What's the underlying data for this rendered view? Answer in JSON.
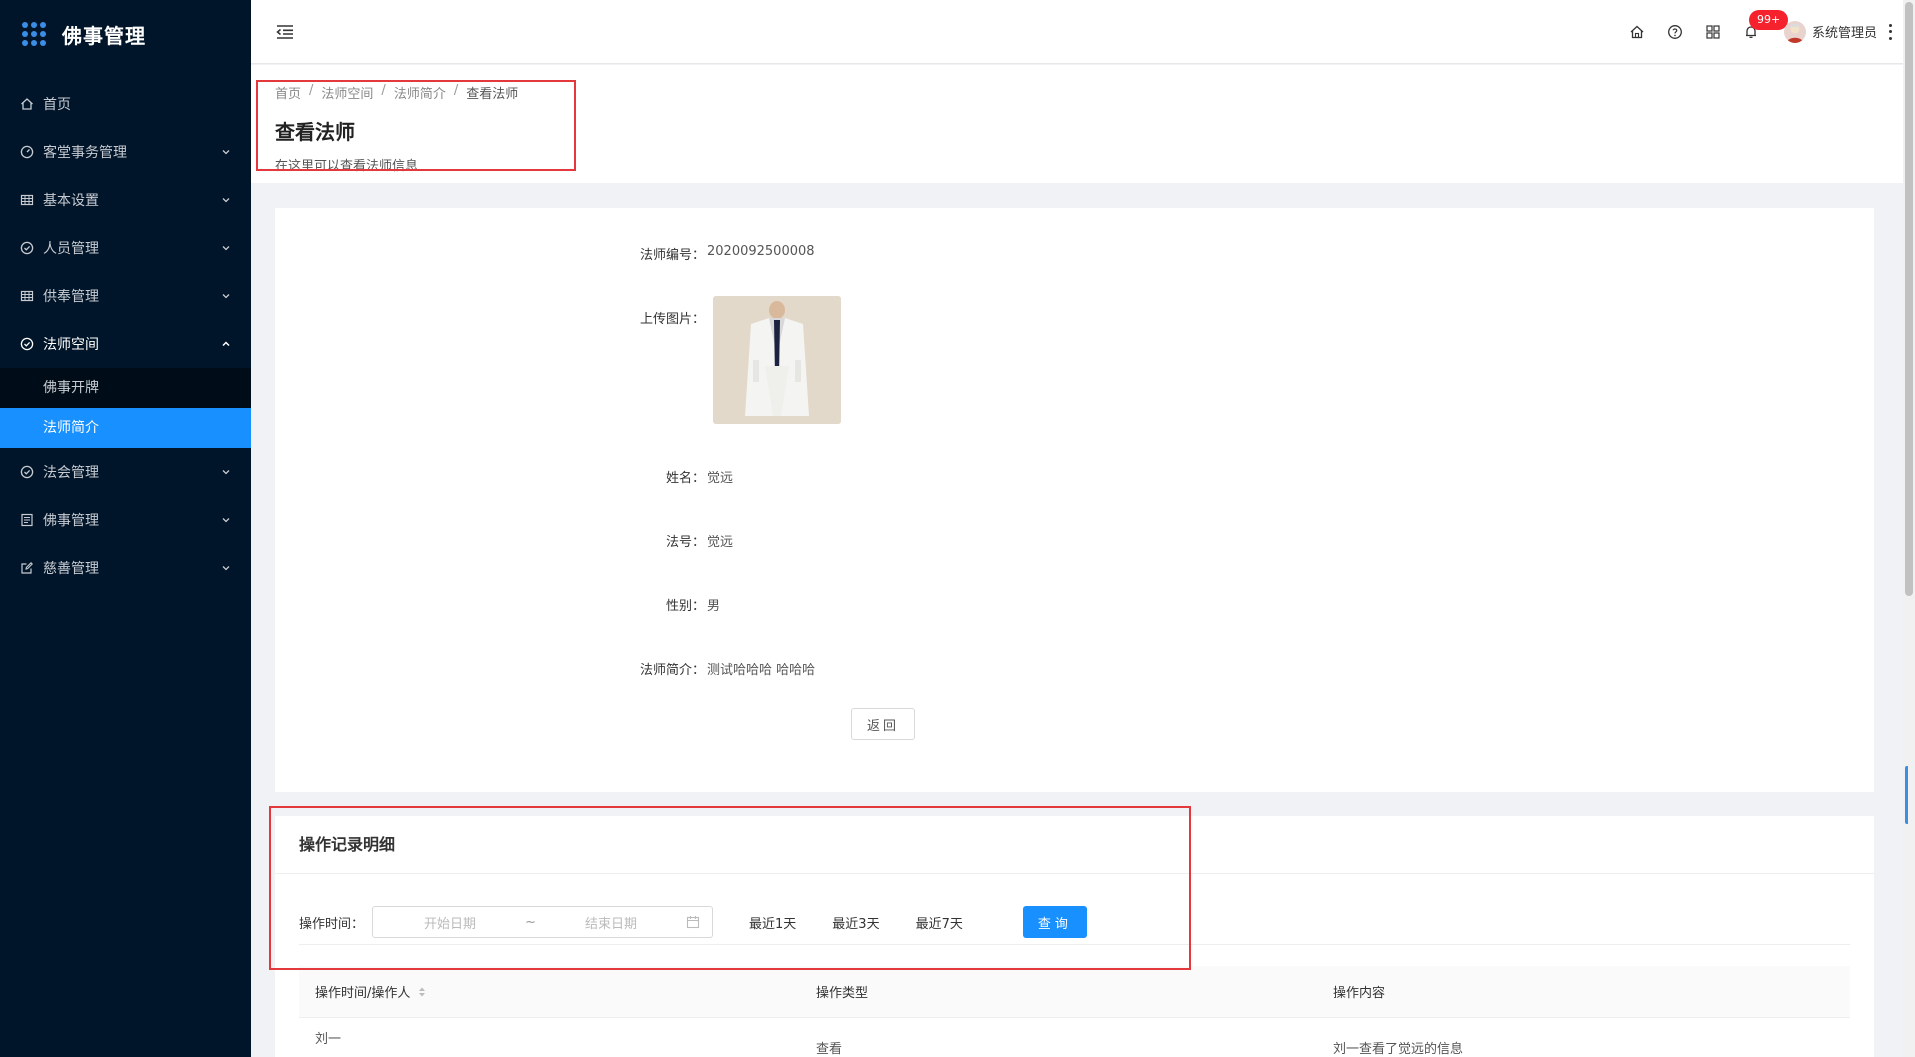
{
  "app": {
    "title": "佛事管理"
  },
  "sidebar": {
    "items": [
      {
        "label": "首页",
        "icon": "home-icon",
        "expandable": false
      },
      {
        "label": "客堂事务管理",
        "icon": "dashboard-icon",
        "expandable": true
      },
      {
        "label": "基本设置",
        "icon": "table-icon",
        "expandable": true
      },
      {
        "label": "人员管理",
        "icon": "check-circle-icon",
        "expandable": true
      },
      {
        "label": "供奉管理",
        "icon": "table-icon",
        "expandable": true
      },
      {
        "label": "法师空间",
        "icon": "check-circle-icon",
        "expandable": true,
        "open": true
      },
      {
        "label": "法会管理",
        "icon": "check-circle-icon",
        "expandable": true
      },
      {
        "label": "佛事管理",
        "icon": "list-icon",
        "expandable": true
      },
      {
        "label": "慈善管理",
        "icon": "edit-icon",
        "expandable": true
      }
    ],
    "submenu": [
      {
        "label": "佛事开牌",
        "active": false
      },
      {
        "label": "法师简介",
        "active": true
      }
    ]
  },
  "topbar": {
    "badge": "99+",
    "user_name": "系统管理员"
  },
  "breadcrumb": [
    "首页",
    "法师空间",
    "法师简介",
    "查看法师"
  ],
  "page": {
    "title": "查看法师",
    "description": "在这里可以查看法师信息"
  },
  "detail": {
    "number_label": "法师编号：",
    "number_value": "2020092500008",
    "photo_label": "上传图片：",
    "name_label": "姓名：",
    "name_value": "觉远",
    "dharma_label": "法号：",
    "dharma_value": "觉远",
    "gender_label": "性别：",
    "gender_value": "男",
    "intro_label": "法师简介：",
    "intro_value": "测试哈哈哈 哈哈哈",
    "back_label": "返回"
  },
  "log": {
    "title": "操作记录明细",
    "time_label": "操作时间：",
    "start_placeholder": "开始日期",
    "end_placeholder": "结束日期",
    "range_separator": "~",
    "quick_1": "最近1天",
    "quick_3": "最近3天",
    "quick_7": "最近7天",
    "query_label": "查询",
    "columns": [
      "操作时间/操作人",
      "操作类型",
      "操作内容"
    ],
    "rows": [
      {
        "operator": "刘一",
        "type": "查看",
        "content": "刘一查看了觉远的信息"
      }
    ]
  },
  "colors": {
    "sidebar_bg": "#001529",
    "accent": "#1890ff",
    "highlight": "#e4393c",
    "badge": "#f5222d"
  }
}
